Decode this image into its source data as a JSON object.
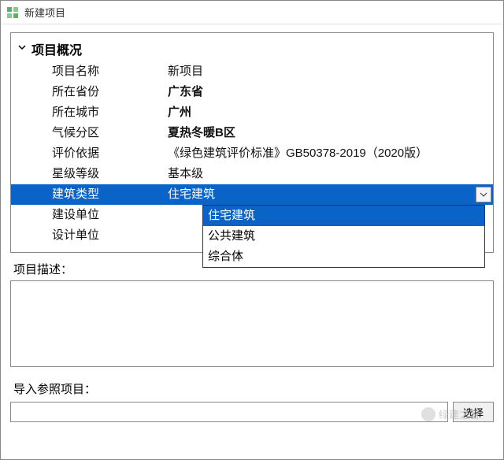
{
  "window": {
    "title": "新建项目"
  },
  "section": {
    "header": "项目概况"
  },
  "rows": {
    "project_name": {
      "label": "项目名称",
      "value": "新项目"
    },
    "province": {
      "label": "所在省份",
      "value": "广东省"
    },
    "city": {
      "label": "所在城市",
      "value": "广州"
    },
    "climate": {
      "label": "气候分区",
      "value": "夏热冬暖B区"
    },
    "basis": {
      "label": "评价依据",
      "value": "《绿色建筑评价标准》GB50378-2019（2020版）"
    },
    "star": {
      "label": "星级等级",
      "value": "基本级"
    },
    "building_type": {
      "label": "建筑类型",
      "value": "住宅建筑"
    },
    "builder": {
      "label": "建设单位",
      "value": ""
    },
    "designer": {
      "label": "设计单位",
      "value": ""
    }
  },
  "dropdown": {
    "options": [
      "住宅建筑",
      "公共建筑",
      "综合体"
    ]
  },
  "description": {
    "label": "项目描述：",
    "value": ""
  },
  "import": {
    "label": "导入参照项目：",
    "value": "",
    "button": "选择"
  },
  "watermark": "绿建之窗"
}
